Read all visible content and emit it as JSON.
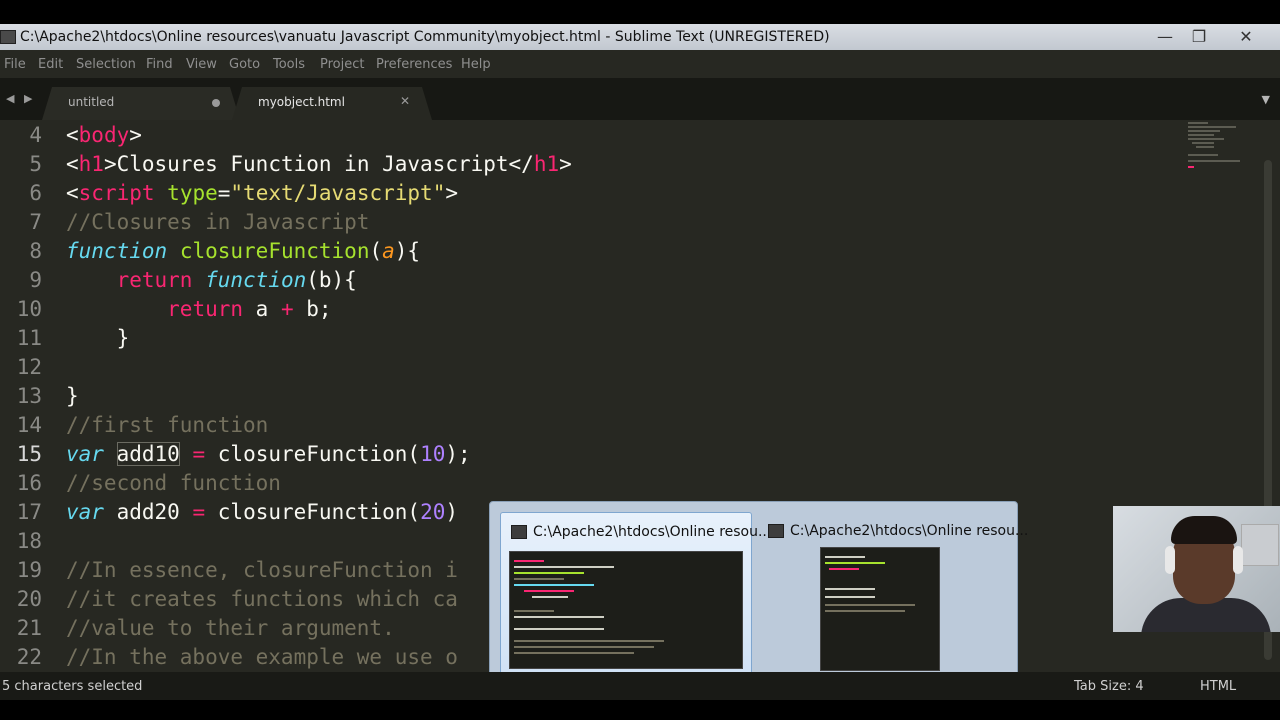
{
  "window": {
    "title": "C:\\Apache2\\htdocs\\Online resources\\vanuatu Javascript Community\\myobject.html - Sublime Text (UNREGISTERED)",
    "minimize": "—",
    "maximize": "❐",
    "close": "✕"
  },
  "menu": [
    "File",
    "Edit",
    "Selection",
    "Find",
    "View",
    "Goto",
    "Tools",
    "Project",
    "Preferences",
    "Help"
  ],
  "tabs": [
    {
      "label": "untitled",
      "dirty": true
    },
    {
      "label": "myobject.html",
      "active": true
    }
  ],
  "code": {
    "line_numbers": [
      "4",
      "5",
      "6",
      "7",
      "8",
      "9",
      "10",
      "11",
      "12",
      "13",
      "14",
      "15",
      "16",
      "17",
      "18",
      "19",
      "20",
      "21",
      "22"
    ],
    "current_line": "15",
    "l4": {
      "a": "<",
      "b": "body",
      "c": ">"
    },
    "l5": {
      "a": "<",
      "b": "h1",
      "c": ">Closures Function in Javascript</",
      "d": "h1",
      "e": ">"
    },
    "l6": {
      "a": "<",
      "b": "script",
      "c": " ",
      "d": "type",
      "e": "=",
      "f": "\"text/Javascript\"",
      "g": ">"
    },
    "l7": "//Closures in Javascript",
    "l8": {
      "kw": "function",
      "fn": "closureFunction",
      "open": "(",
      "param": "a",
      "close": "){"
    },
    "l9": {
      "ret": "return",
      "kw": "function",
      "rest": "(b){"
    },
    "l10": {
      "ret": "return",
      "a": "a ",
      "op": "+",
      "b": " b;"
    },
    "l11": "}",
    "l13": "}",
    "l14": "//first function",
    "l15": {
      "kw": "var",
      "name": "add10",
      "op": "=",
      "call": "closureFunction(",
      "num": "10",
      "end": ");"
    },
    "l16": "//second function",
    "l17": {
      "kw": "var",
      "name": "add20",
      "op": "=",
      "call": "closureFunction(",
      "num": "20",
      "end": ")"
    },
    "l19": "//In essence, closureFunction i",
    "l20": "//it creates functions which ca",
    "l21": "//value to their argument.",
    "l22": "//In the above example we use o"
  },
  "status": {
    "selection": "5 characters selected",
    "tab_size": "Tab Size: 4",
    "syntax": "HTML"
  },
  "taskbar_preview": {
    "items": [
      {
        "label": "C:\\Apache2\\htdocs\\Online resou...",
        "active": true
      },
      {
        "label": "C:\\Apache2\\htdocs\\Online resou...",
        "active": false
      }
    ]
  },
  "colors": {
    "editor_bg": "#272822",
    "tag": "#f92672",
    "attribute": "#a6e22e",
    "string": "#e6db74",
    "comment": "#75715e",
    "keyword": "#66d9ef",
    "number": "#ae81ff",
    "parameter": "#fd971f"
  }
}
